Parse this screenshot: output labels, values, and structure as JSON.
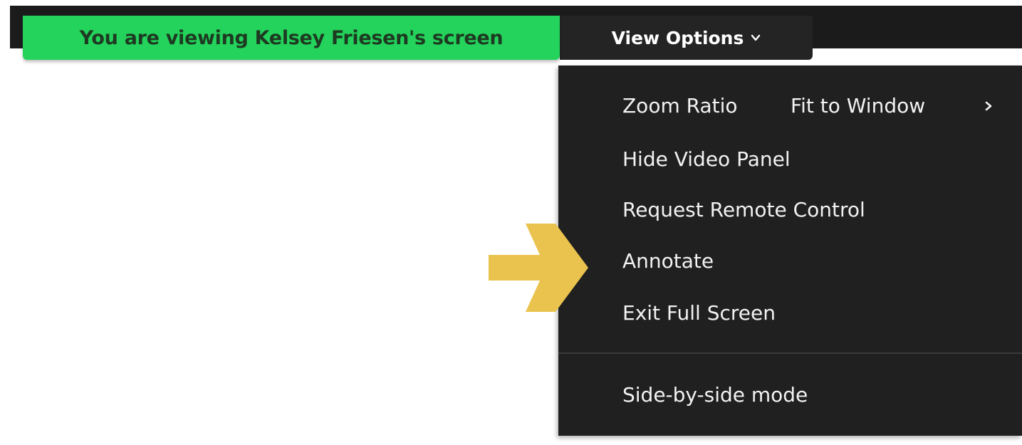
{
  "banner": {
    "text": "You are viewing Kelsey Friesen's screen",
    "color": "#23d35b"
  },
  "view_options": {
    "label": "View Options",
    "icon": "chevron-down-icon"
  },
  "menu": {
    "zoom_ratio": {
      "label": "Zoom Ratio",
      "value": "Fit to Window",
      "icon": "chevron-right-icon"
    },
    "items": [
      {
        "label": "Hide Video Panel"
      },
      {
        "label": "Request Remote Control"
      },
      {
        "label": "Annotate"
      },
      {
        "label": "Exit Full Screen"
      }
    ],
    "side_by_side": {
      "label": "Side-by-side mode"
    }
  },
  "annotation": {
    "icon": "arrow-right-icon",
    "color": "#e9c34d"
  }
}
